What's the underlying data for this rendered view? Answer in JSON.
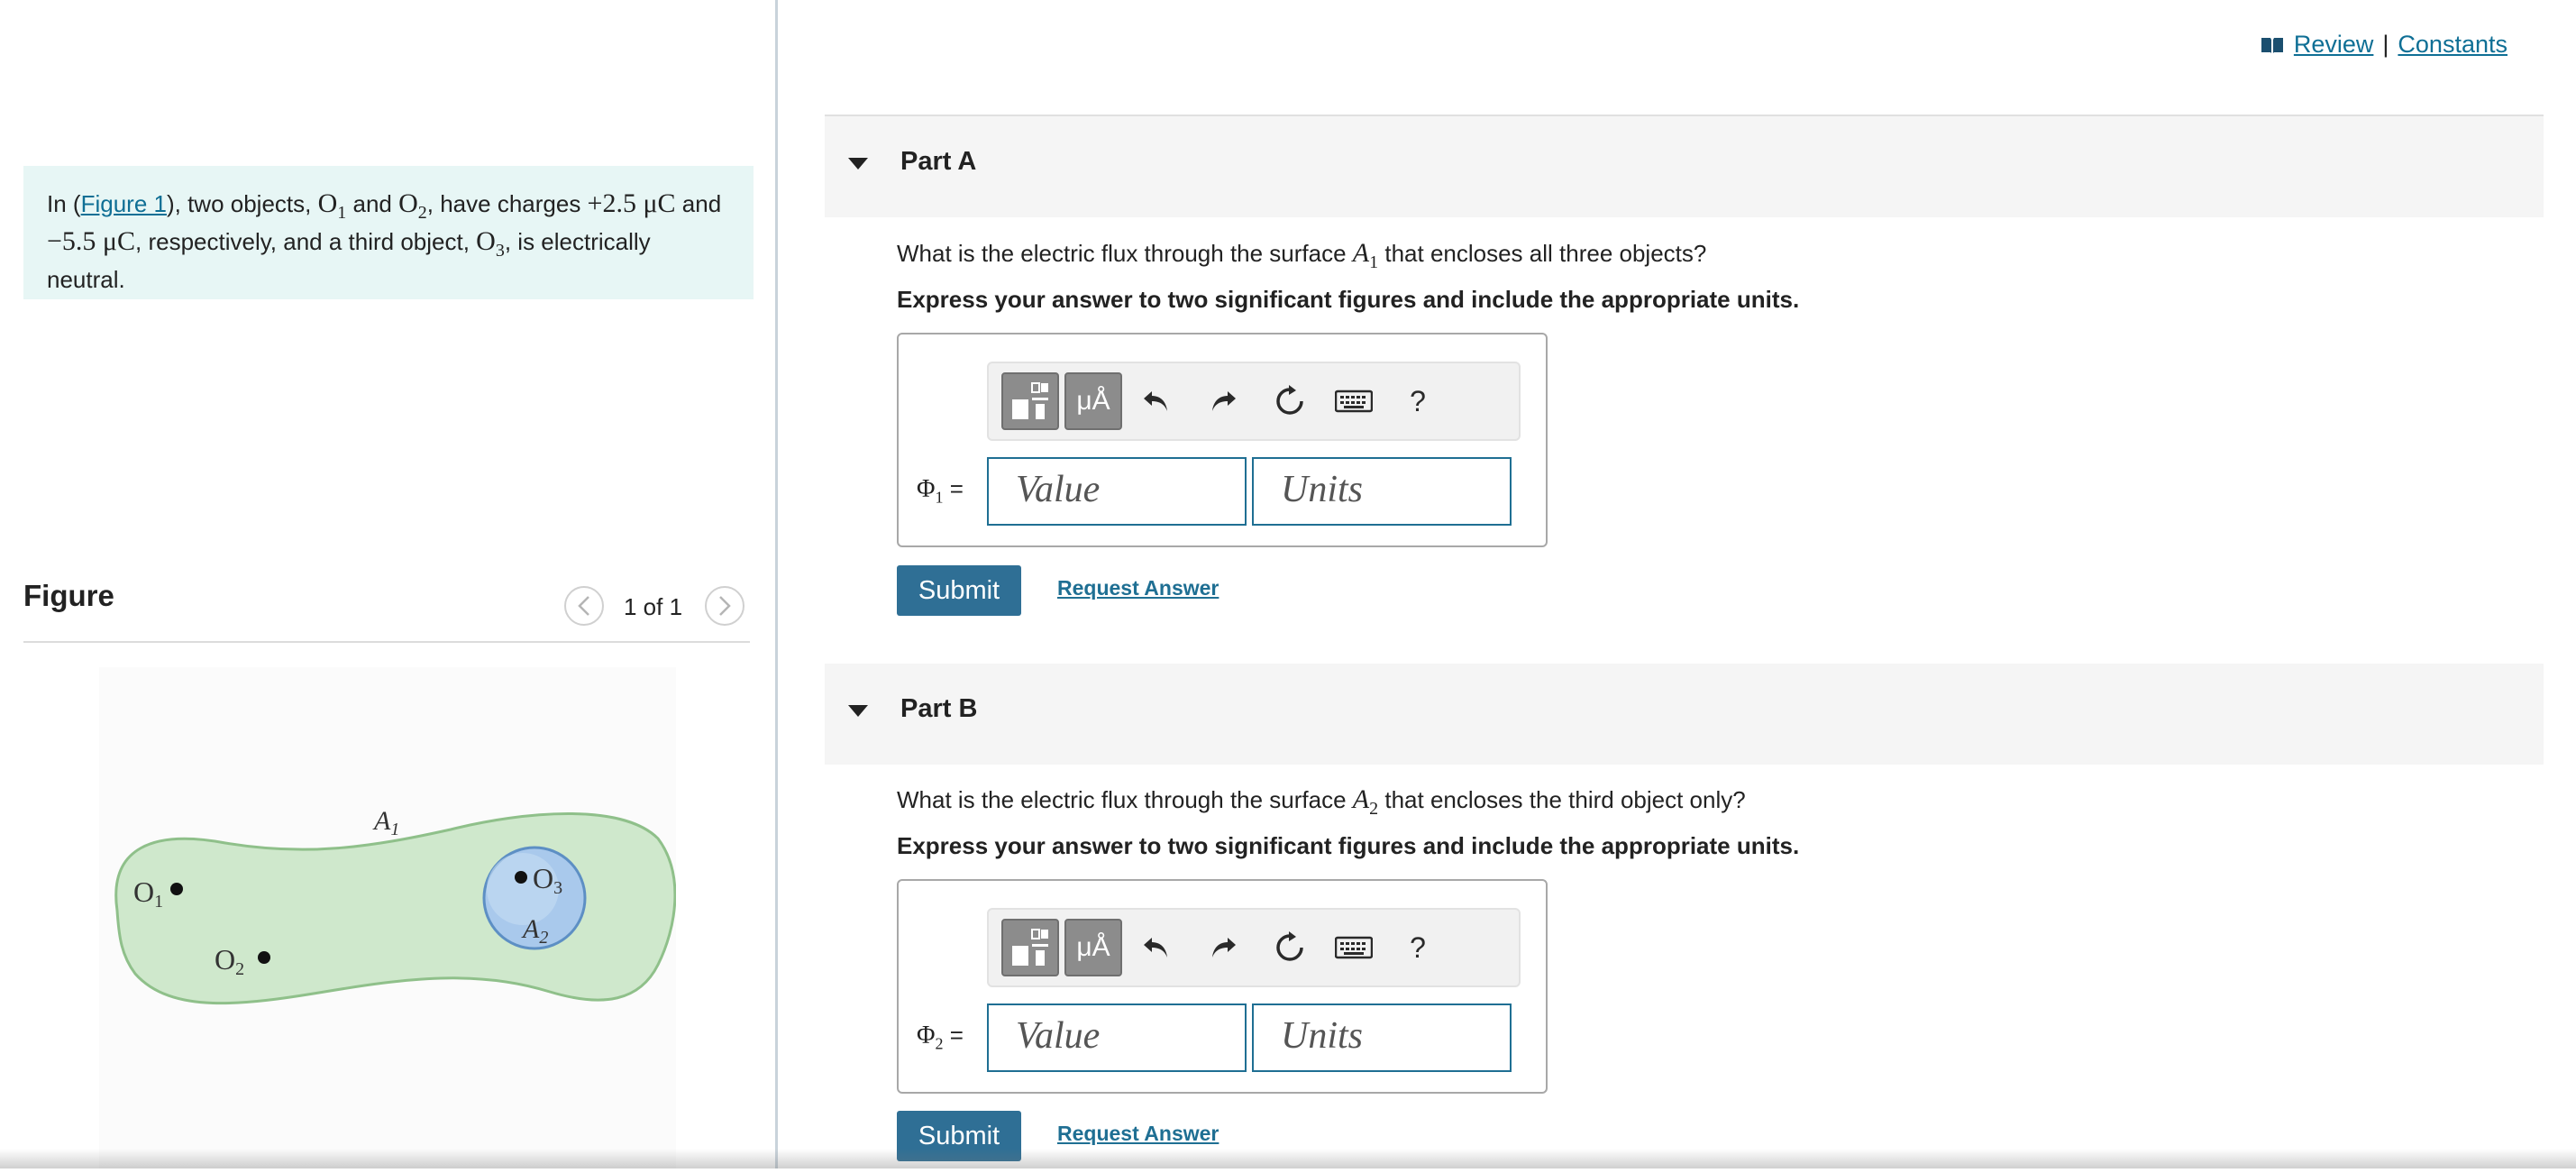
{
  "intro": {
    "prefix": "In (",
    "figure_link": "Figure 1",
    "t1": "), two objects, ",
    "o1": "O",
    "o1_sub": "1",
    "t2": " and ",
    "o2": "O",
    "o2_sub": "2",
    "t3": ", have charges ",
    "charge1": "+2.5 μC",
    "t4": " and ",
    "charge2": "−5.5 μC",
    "t5": ", respectively, and a third object, ",
    "o3": "O",
    "o3_sub": "3",
    "t6": ", is electrically neutral."
  },
  "figure": {
    "title": "Figure",
    "page": "1 of 1",
    "labels": {
      "a1": "A",
      "a1_sub": "1",
      "a2": "A",
      "a2_sub": "2",
      "o1": "O",
      "o1_sub": "1",
      "o2": "O",
      "o2_sub": "2",
      "o3": "O",
      "o3_sub": "3"
    },
    "colors": {
      "surface_fill": "#cfe8cc",
      "surface_stroke": "#8fc08a",
      "sphere_fill": "#a9c9ec",
      "sphere_stroke": "#5d8fc4"
    }
  },
  "header": {
    "review": "Review",
    "separator": "|",
    "constants": "Constants"
  },
  "parts": [
    {
      "title": "Part A",
      "question_pre": "What is the electric flux through the surface ",
      "surface": "A",
      "surface_sub": "1",
      "question_post": " that encloses all three objects?",
      "instruction": "Express your answer to two significant figures and include the appropriate units.",
      "phi": "Φ",
      "phi_sub": "1",
      "eq": "=",
      "value_placeholder": "Value",
      "units_placeholder": "Units",
      "submit": "Submit",
      "request": "Request Answer"
    },
    {
      "title": "Part B",
      "question_pre": "What is the electric flux through the surface ",
      "surface": "A",
      "surface_sub": "2",
      "question_post": " that encloses the third object only?",
      "instruction": "Express your answer to two significant figures and include the appropriate units.",
      "phi": "Φ",
      "phi_sub": "2",
      "eq": "=",
      "value_placeholder": "Value",
      "units_placeholder": "Units",
      "submit": "Submit",
      "request": "Request Answer"
    }
  ],
  "toolbar": {
    "units_symbol": "μÅ",
    "help": "?"
  },
  "colors": {
    "accent": "#2f6f95",
    "intro_bg": "#e7f6f5",
    "link": "#0f6f95"
  }
}
